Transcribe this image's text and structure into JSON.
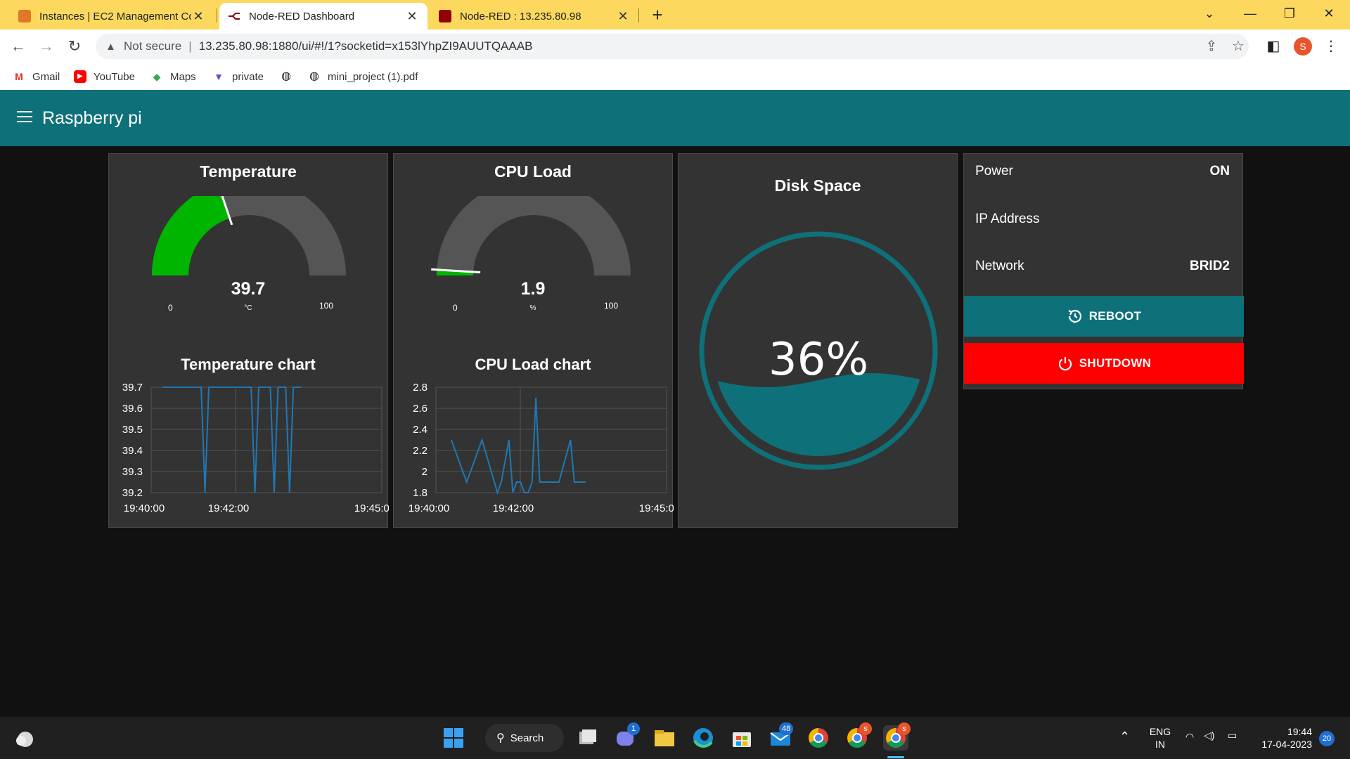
{
  "browser": {
    "tabs": [
      {
        "title": "Instances | EC2 Management Cor",
        "active": false
      },
      {
        "title": "Node-RED Dashboard",
        "active": true
      },
      {
        "title": "Node-RED : 13.235.80.98",
        "active": false
      }
    ],
    "new_tab": "+",
    "address": {
      "security": "Not secure",
      "url": "13.235.80.98:1880/ui/#!/1?socketid=x153lYhpZI9AUUTQAAAB"
    },
    "profile_initial": "S",
    "bookmarks": [
      {
        "label": "Gmail",
        "icon": "gmail-icon"
      },
      {
        "label": "YouTube",
        "icon": "youtube-icon"
      },
      {
        "label": "Maps",
        "icon": "maps-icon"
      },
      {
        "label": "private",
        "icon": "private-icon"
      },
      {
        "label": "",
        "icon": "globe-icon"
      },
      {
        "label": "mini_project (1).pdf",
        "icon": "globe-icon"
      }
    ]
  },
  "dashboard": {
    "title": "Raspberry pi",
    "temperature": {
      "title": "Temperature",
      "value": "39.7",
      "unit": "°C",
      "min": "0",
      "max": "100",
      "level": 39.7
    },
    "cpu": {
      "title": "CPU Load",
      "value": "1.9",
      "unit": "%",
      "min": "0",
      "max": "100",
      "level": 1.9
    },
    "disk": {
      "title": "Disk Space",
      "value": "36%",
      "level": 36
    },
    "power": {
      "label": "Power",
      "value": "ON"
    },
    "ip": {
      "label": "IP Address",
      "value": ""
    },
    "network": {
      "label": "Network",
      "value": "BRID2"
    },
    "reboot_label": "REBOOT",
    "shutdown_label": "SHUTDOWN"
  },
  "chart_data": [
    {
      "type": "line",
      "title": "Temperature chart",
      "ticks_x": [
        "19:40:00",
        "19:42:00",
        "19:45:00"
      ],
      "ticks_y": [
        "39.7",
        "39.6",
        "39.5",
        "39.4",
        "39.3",
        "39.2"
      ],
      "ylim": [
        39.2,
        39.7
      ],
      "xlim": [
        0,
        300
      ],
      "series": [
        {
          "color": "#1f77b4",
          "x": [
            15,
            65,
            70,
            75,
            80,
            100,
            120,
            130,
            135,
            140,
            155,
            160,
            165,
            170,
            175,
            180,
            185,
            190,
            195
          ],
          "y": [
            39.7,
            39.7,
            39.2,
            39.7,
            39.7,
            39.7,
            39.7,
            39.7,
            39.2,
            39.7,
            39.7,
            39.2,
            39.7,
            39.7,
            39.7,
            39.2,
            39.7,
            39.7,
            39.7
          ]
        }
      ]
    },
    {
      "type": "line",
      "title": "CPU Load chart",
      "ticks_x": [
        "19:40:00",
        "19:42:00",
        "19:45:00"
      ],
      "ticks_y": [
        "2.8",
        "2.6",
        "2.4",
        "2.2",
        "2",
        "1.8"
      ],
      "ylim": [
        1.8,
        2.8
      ],
      "xlim": [
        0,
        300
      ],
      "series": [
        {
          "color": "#1f77b4",
          "x": [
            20,
            40,
            60,
            80,
            85,
            95,
            100,
            105,
            110,
            115,
            120,
            125,
            130,
            135,
            160,
            175,
            180,
            185,
            190,
            195
          ],
          "y": [
            2.3,
            1.9,
            2.3,
            1.8,
            1.9,
            2.3,
            1.8,
            1.9,
            1.9,
            1.8,
            1.8,
            1.9,
            2.7,
            1.9,
            1.9,
            2.3,
            1.9,
            1.9,
            1.9,
            1.9
          ]
        }
      ]
    }
  ],
  "taskbar": {
    "search": "Search",
    "badges": {
      "teams": "1",
      "mail": "48",
      "chrome_a": "s",
      "chrome_b": "s"
    },
    "lang_top": "ENG",
    "lang_bottom": "IN",
    "time": "19:44",
    "date": "17-04-2023",
    "notifications": "20"
  },
  "colors": {
    "header": "#0e7179",
    "reboot": "#0e7179",
    "shutdown": "#ff0000",
    "gauge_temp": "#00b500",
    "gauge_cpu": "#00b500",
    "disk_fill": "#0e7179",
    "tab_bar": "#fcd95e"
  }
}
